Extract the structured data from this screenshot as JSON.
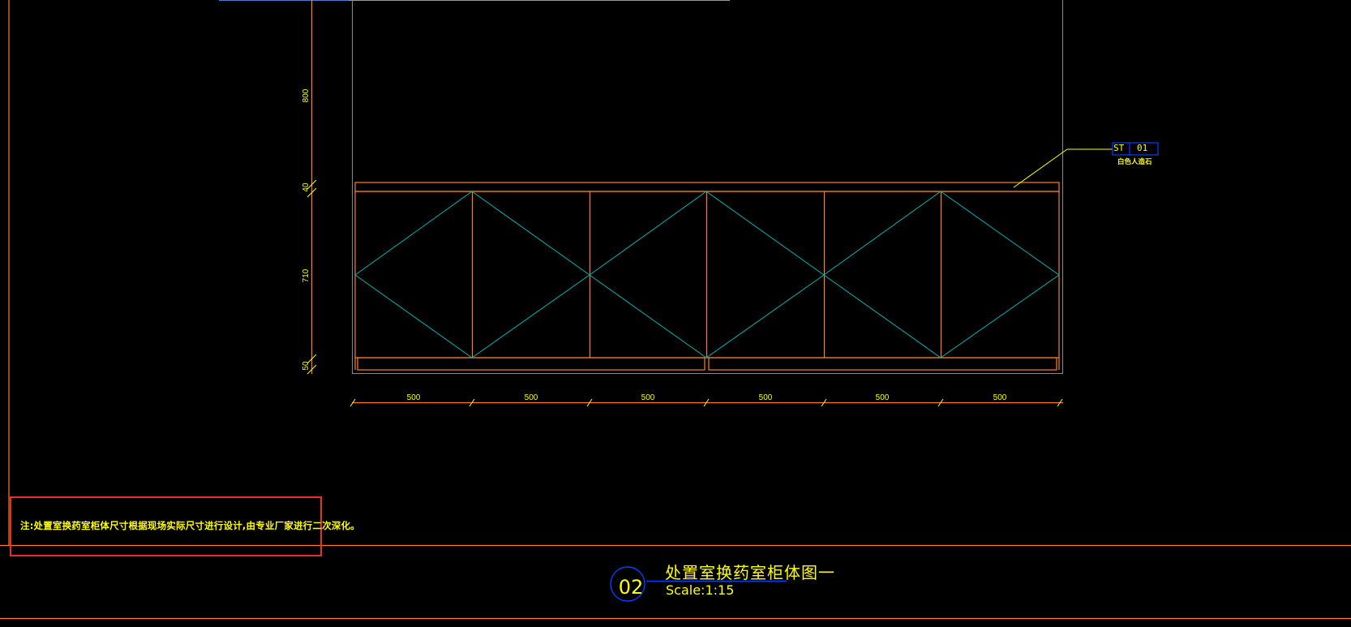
{
  "colors": {
    "background": "#000000",
    "frame": "#ff7f27",
    "cabinet": "#ff7f27",
    "panel_diagonals": "#00b4b4",
    "dimension": "#ffff00",
    "guide_lines": "#808080",
    "callout_circle": "#0040ff",
    "highlight_box": "#e8302a"
  },
  "drawing": {
    "vertical_dimensions": [
      "800",
      "40",
      "710",
      "50"
    ],
    "horizontal_dimensions": [
      "500",
      "500",
      "500",
      "500",
      "500",
      "500"
    ],
    "material_tag": {
      "code": "ST",
      "number": "01",
      "description": "白色人造石"
    }
  },
  "note": {
    "text": "注:处置室换药室柜体尺寸根据现场实际尺寸进行设计,由专业厂家进行二次深化。"
  },
  "title_block": {
    "number": "02",
    "title": "处置室换药室柜体图一",
    "scale": "Scale:1:15"
  }
}
